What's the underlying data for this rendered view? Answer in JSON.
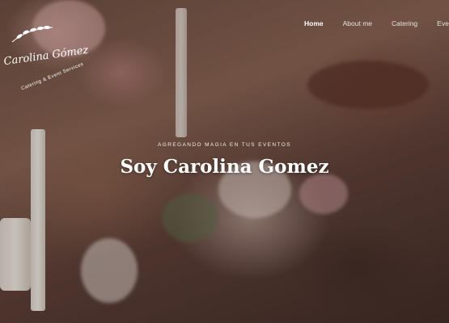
{
  "logo": {
    "name": "Carolina Gómez",
    "subtitle": "Catering & Event Services"
  },
  "nav": {
    "items": [
      {
        "label": "Home",
        "active": true
      },
      {
        "label": "About me",
        "active": false
      },
      {
        "label": "Catering",
        "active": false
      },
      {
        "label": "Eventos",
        "active": false
      }
    ]
  },
  "hero": {
    "tagline": "AGREGANDO MAGIA EN TUS EVENTOS",
    "title": "Soy Carolina Gomez"
  },
  "colors": {
    "text": "#ffffff",
    "background": "#6b4e42"
  }
}
